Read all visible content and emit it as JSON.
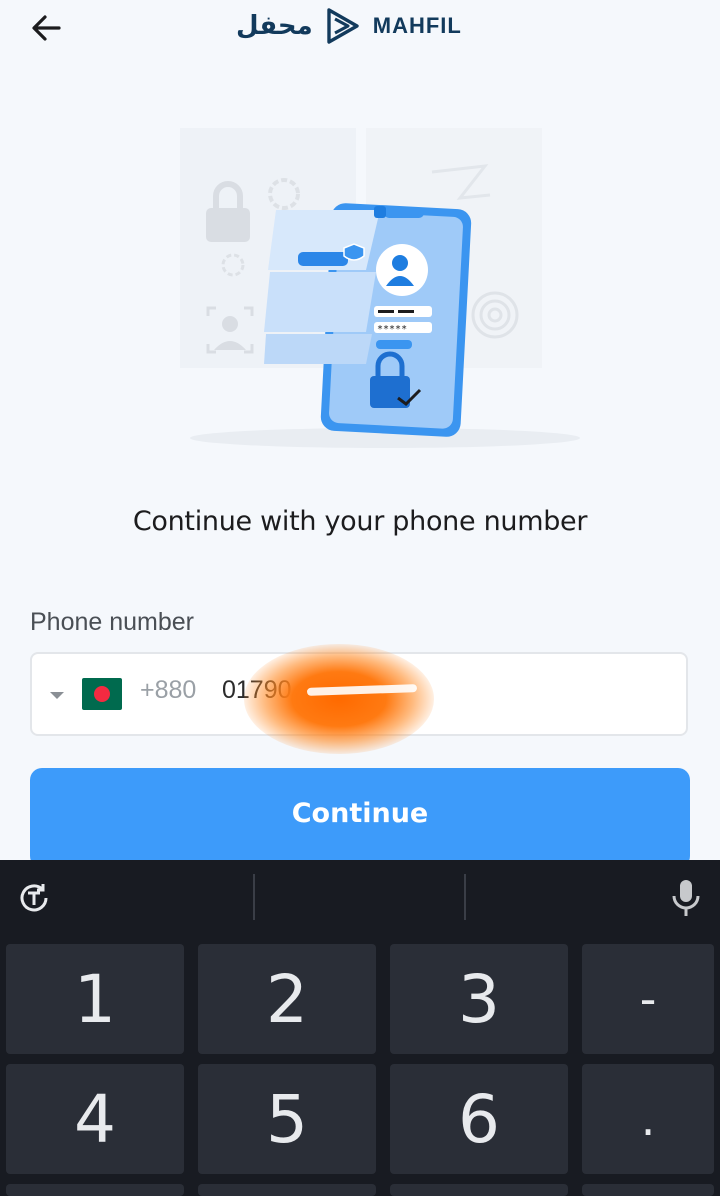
{
  "header": {
    "back_icon": "arrow-left-icon",
    "logo_arabic": "محفل",
    "logo_latin": "MAHFIL",
    "logo_icon": "play-triangle-logo-icon",
    "brand_color": "#123a5c"
  },
  "illustration": {
    "name": "phone-login-security-illustration",
    "password_mask": "*****"
  },
  "main": {
    "title": "Continue with your phone number",
    "phone_label": "Phone number",
    "country_flag": "bangladesh-flag-icon",
    "dial_code": "+880",
    "phone_value": "01790",
    "continue_label": "Continue",
    "accent_color": "#3d9bfa"
  },
  "keyboard": {
    "toolbar_left_icon": "translate-t-icon",
    "toolbar_right_icon": "microphone-icon",
    "keys": [
      "1",
      "2",
      "3",
      "-",
      "4",
      "5",
      "6",
      "."
    ]
  }
}
